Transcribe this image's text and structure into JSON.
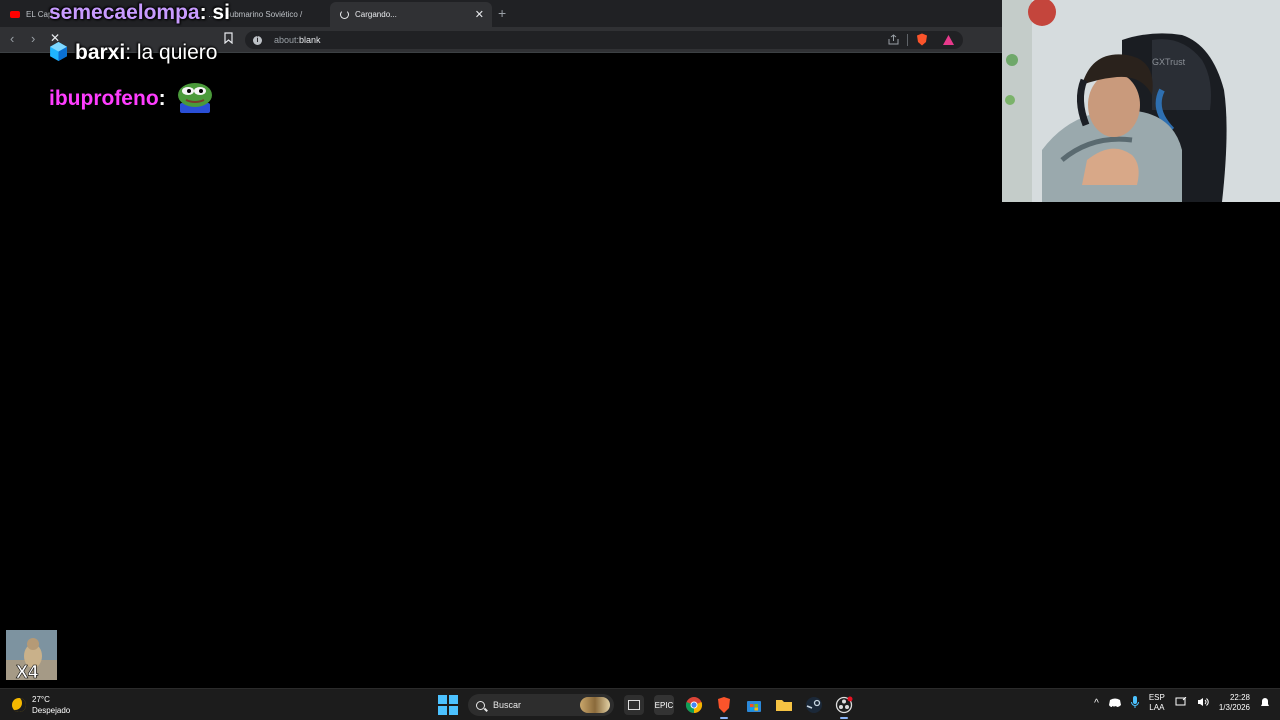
{
  "browser": {
    "tabs": [
      {
        "label": "EL Cap",
        "state": "inactive"
      },
      {
        "label": "…el Submarino Soviético /",
        "state": "inactive"
      },
      {
        "label": "Cargando...",
        "state": "active"
      }
    ],
    "address_bar": {
      "prefix": "about:",
      "value": "blank"
    },
    "colors": {
      "chrome": "#202124",
      "toolbar": "#303134",
      "brave_orange": "#fb542b"
    }
  },
  "chat": {
    "messages": [
      {
        "user": "semecaelompa",
        "text": ": si",
        "color": "#c89bff"
      },
      {
        "user": "barxi",
        "text": ": la quiero",
        "color": "#ffffff",
        "badge": "cube-icon"
      },
      {
        "user": "ibuprofeno",
        "text": ":",
        "color": "#ff3dff",
        "emote": "pepe-emote-icon"
      }
    ]
  },
  "webcam": {
    "chair_brand": "GXTrust"
  },
  "thumbnail": {
    "label": "X4"
  },
  "taskbar": {
    "weather": {
      "temp": "27°C",
      "condition": "Despejado"
    },
    "search_placeholder": "Buscar",
    "apps": [
      "task-view-icon",
      "epic-games-icon",
      "chrome-icon",
      "brave-icon",
      "store-icon",
      "file-explorer-icon",
      "steam-icon",
      "obs-icon"
    ],
    "tray": {
      "lang_top": "ESP",
      "lang_bottom": "LAA",
      "time": "22:28",
      "date": "1/3/2026"
    },
    "accent": "#4cc2ff"
  }
}
